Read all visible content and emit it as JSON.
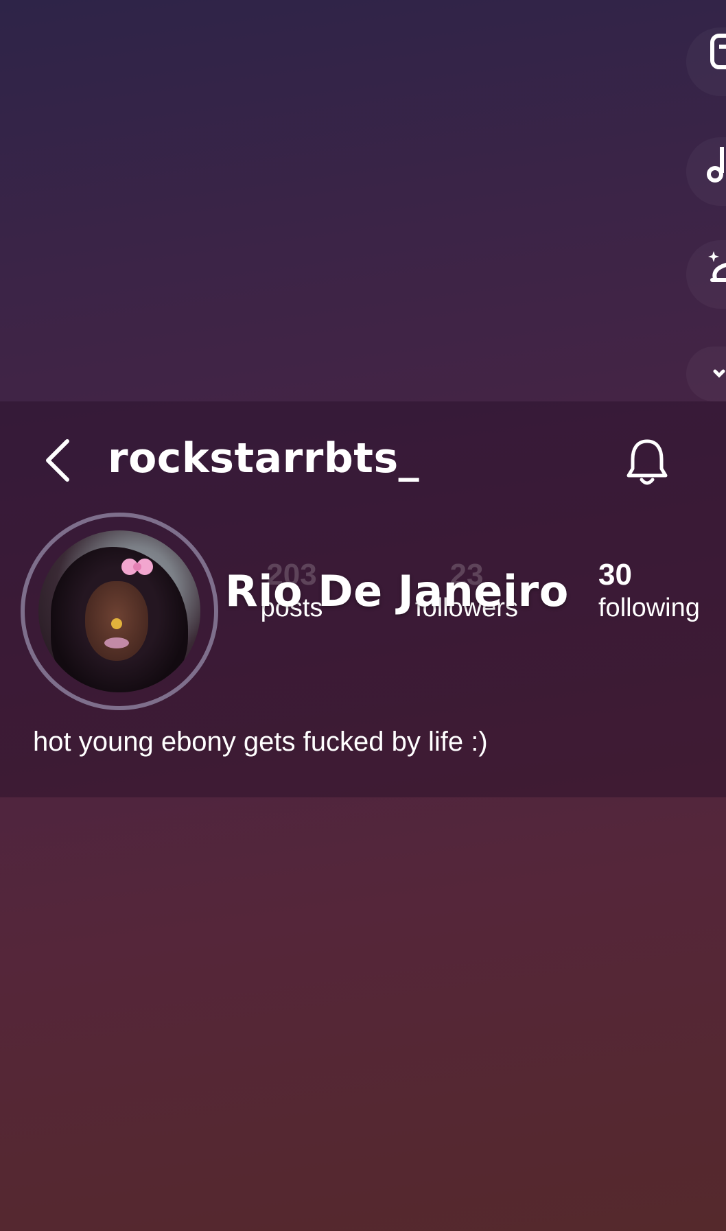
{
  "story_tools": [
    {
      "icon": "text-icon"
    },
    {
      "icon": "music-note-icon"
    },
    {
      "icon": "sparkle-effects-icon"
    },
    {
      "icon": "chevron-down-icon"
    }
  ],
  "profile": {
    "username": "rockstarrbts_",
    "location_sticker": "Rio De Janeiro",
    "bio": "hot young ebony gets fucked by life :)",
    "stats": {
      "posts": {
        "value": "203",
        "label": "posts"
      },
      "followers": {
        "value": "23",
        "label": "followers"
      },
      "following": {
        "value": "30",
        "label": "following"
      }
    }
  },
  "icons": {
    "back": "back-chevron-icon",
    "bell": "bell-icon"
  },
  "colors": {
    "background_top": "#2e2448",
    "background_bottom": "#55292c",
    "card": "#281028",
    "text": "#ffffff"
  }
}
